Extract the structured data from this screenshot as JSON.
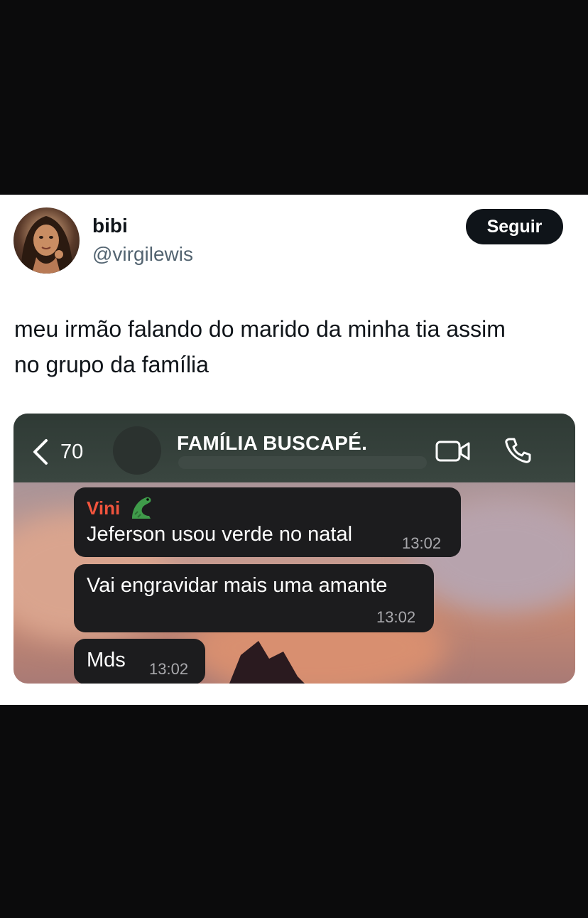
{
  "tweet": {
    "display_name": "bibi",
    "handle": "@virgilewis",
    "follow_label": "Seguir",
    "text_line1": "meu irmão falando do marido da minha tia assim",
    "text_line2": "no grupo da família"
  },
  "chat": {
    "back_count": "70",
    "group_name": "FAMÍLIA BUSCAPÉ.",
    "messages": [
      {
        "sender": "Vini",
        "text": "Jeferson usou verde no natal",
        "time": "13:02"
      },
      {
        "text": "Vai engravidar mais uma amante",
        "time": "13:02"
      },
      {
        "text": "Mds",
        "time": "13:02"
      }
    ]
  },
  "colors": {
    "follow_bg": "#0f1419",
    "sender_name": "#f0543d",
    "bubble": "#1c1c1e"
  },
  "icons": {
    "back": "chevron-left-icon",
    "video": "video-camera-icon",
    "phone": "phone-icon",
    "emoji": "crocodile-emoji-icon"
  }
}
